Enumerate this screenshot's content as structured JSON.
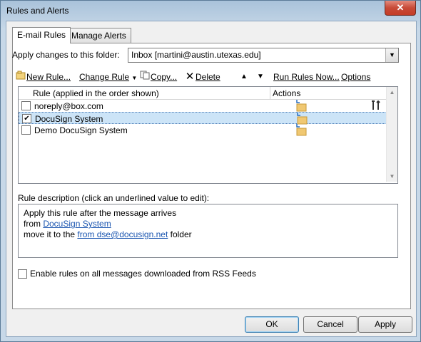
{
  "window": {
    "title": "Rules and Alerts",
    "close_label": "✕"
  },
  "tabs": [
    {
      "label": "E-mail Rules",
      "active": true
    },
    {
      "label": "Manage Alerts",
      "active": false
    }
  ],
  "folder": {
    "label": "Apply changes to this folder:",
    "value": "Inbox [martini@austin.utexas.edu]"
  },
  "toolbar": {
    "new_rule": "New Rule...",
    "change_rule": "Change Rule",
    "copy": "Copy...",
    "delete": "Delete",
    "run_rules": "Run Rules Now...",
    "options": "Options"
  },
  "rules_table": {
    "headers": [
      "Rule (applied in the order shown)",
      "Actions"
    ],
    "rows": [
      {
        "name": "noreply@box.com",
        "checked": false,
        "selected": false
      },
      {
        "name": "DocuSign System",
        "checked": true,
        "selected": true
      },
      {
        "name": "Demo DocuSign System",
        "checked": false,
        "selected": false
      }
    ]
  },
  "description": {
    "label": "Rule description (click an underlined value to edit):",
    "line1": "Apply this rule after the message arrives",
    "line2_prefix": "from ",
    "line2_link": "DocuSign System",
    "line3_prefix": "move it to the ",
    "line3_link": "from dse@docusign.net",
    "line3_suffix": " folder"
  },
  "rss": {
    "label": "Enable rules on all messages downloaded from RSS Feeds",
    "checked": false
  },
  "buttons": {
    "ok": "OK",
    "cancel": "Cancel",
    "apply": "Apply"
  },
  "colors": {
    "selection": "#cce4f7",
    "link": "#1a55b0",
    "close": "#c74a37"
  }
}
